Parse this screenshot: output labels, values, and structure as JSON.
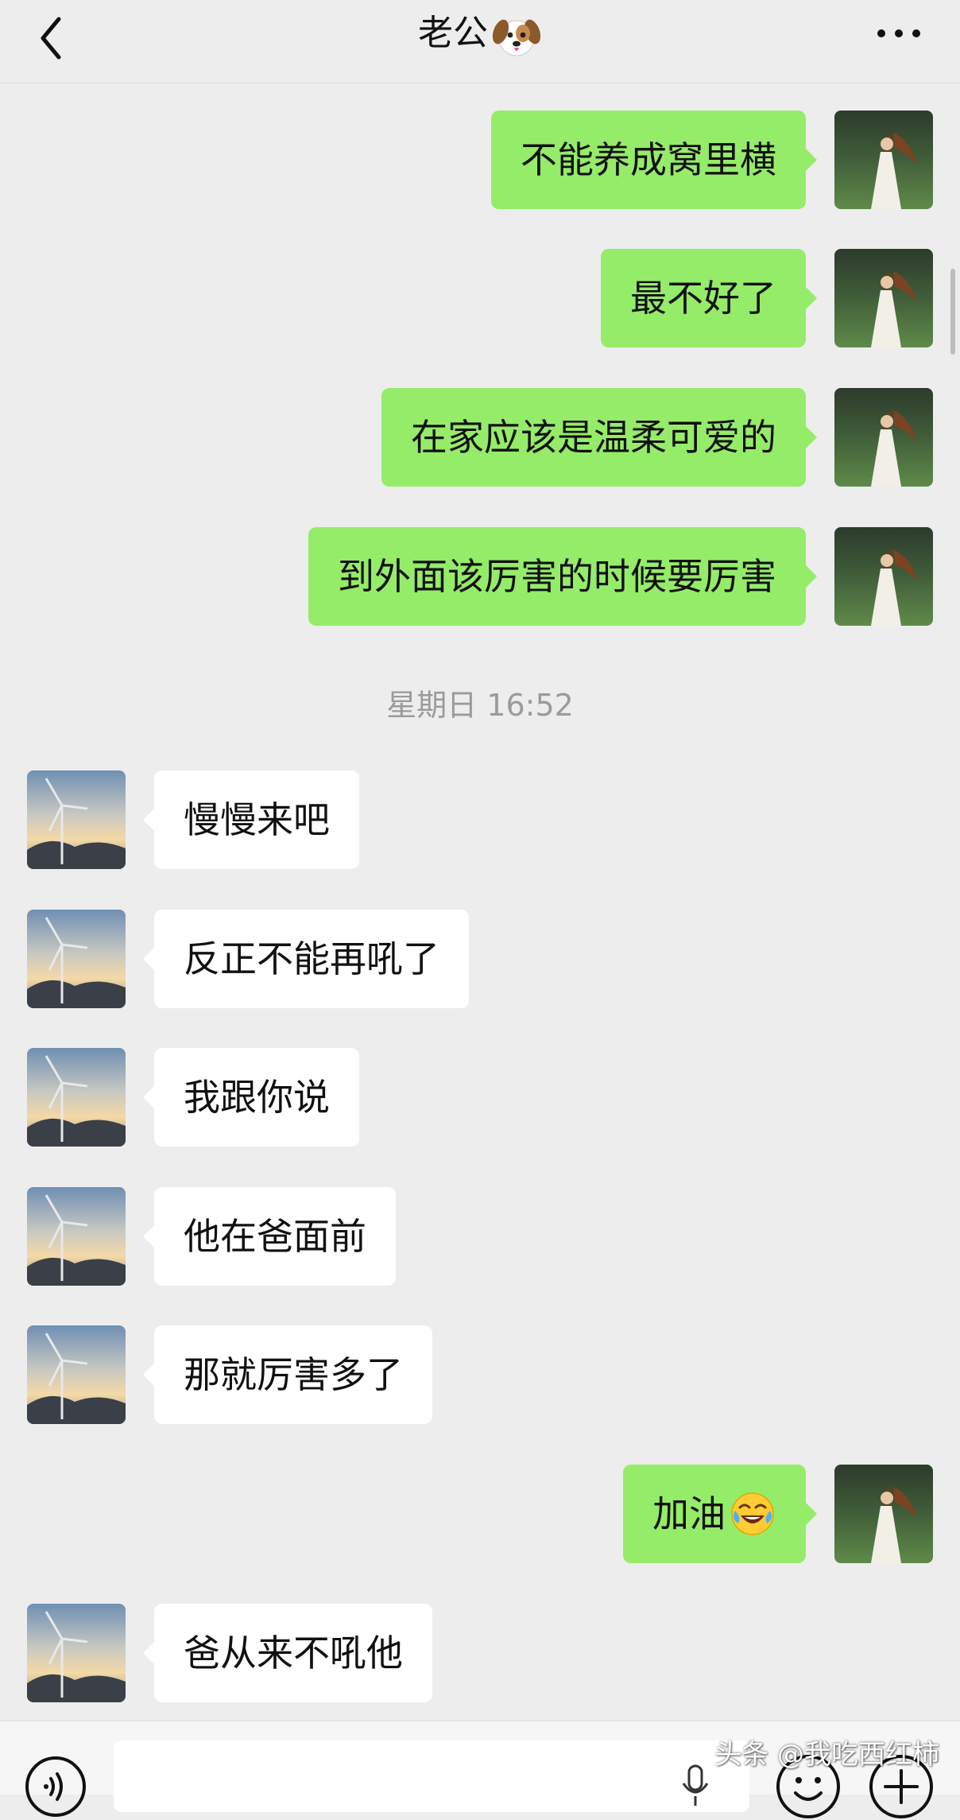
{
  "header": {
    "title": "老公",
    "title_emoji": "dog-face-icon",
    "back_icon": "chevron-left-icon",
    "more_icon": "more-horizontal-icon"
  },
  "messages_before": [
    {
      "direction": "out",
      "text": "不能养成窝里横"
    },
    {
      "direction": "out",
      "text": "最不好了"
    },
    {
      "direction": "out",
      "text": "在家应该是温柔可爱的"
    },
    {
      "direction": "out",
      "text": "到外面该厉害的时候要厉害"
    }
  ],
  "timestamp": "星期日 16:52",
  "messages_after": [
    {
      "direction": "in",
      "text": "慢慢来吧"
    },
    {
      "direction": "in",
      "text": "反正不能再吼了"
    },
    {
      "direction": "in",
      "text": "我跟你说"
    },
    {
      "direction": "in",
      "text": "他在爸面前"
    },
    {
      "direction": "in",
      "text": "那就厉害多了"
    },
    {
      "direction": "out",
      "text": "加油",
      "emoji": "laughing-crying-face-icon"
    },
    {
      "direction": "in",
      "text": "爸从来不吼他"
    }
  ],
  "avatars": {
    "self": "girl-in-field-avatar",
    "contact": "wind-turbine-sunset-avatar"
  },
  "input_bar": {
    "placeholder": "",
    "voice_icon": "voice-input-icon",
    "mic_icon": "microphone-icon",
    "emoji_icon": "emoji-icon",
    "plus_icon": "plus-icon"
  },
  "watermark": "头条 @我吃西红柿",
  "colors": {
    "background": "#ededed",
    "outgoing_bubble": "#95ec69",
    "incoming_bubble": "#ffffff",
    "timestamp": "#9b9b9b"
  }
}
